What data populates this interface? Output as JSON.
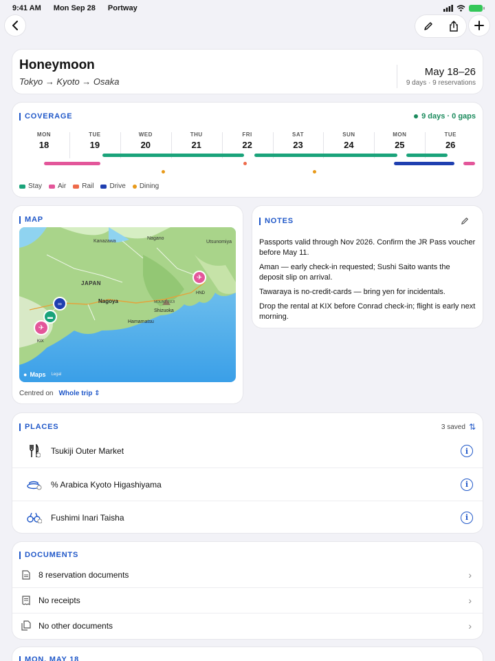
{
  "status": {
    "time": "9:41 AM",
    "date": "Mon Sep 28",
    "app": "Portway"
  },
  "trip": {
    "title": "Honeymoon",
    "route": "Tokyo → Kyoto → Osaka",
    "dates": "May 18–26",
    "summary": "9 days · 9 reservations"
  },
  "coverage": {
    "title": "COVERAGE",
    "status": "9 days · 0 gaps",
    "days": [
      {
        "dow": "MON",
        "num": "18"
      },
      {
        "dow": "TUE",
        "num": "19"
      },
      {
        "dow": "WED",
        "num": "20"
      },
      {
        "dow": "THU",
        "num": "21"
      },
      {
        "dow": "FRI",
        "num": "22"
      },
      {
        "dow": "SAT",
        "num": "23"
      },
      {
        "dow": "SUN",
        "num": "24"
      },
      {
        "dow": "MON",
        "num": "25"
      },
      {
        "dow": "TUE",
        "num": "26"
      }
    ],
    "legend": [
      {
        "label": "Stay",
        "color": "#1aa37a"
      },
      {
        "label": "Air",
        "color": "#e3569a"
      },
      {
        "label": "Rail",
        "color": "#ee6a4a"
      },
      {
        "label": "Drive",
        "color": "#1f3fb0"
      },
      {
        "label": "Dining",
        "color": "#e89a1a"
      }
    ]
  },
  "map": {
    "title": "MAP",
    "labels": {
      "kanazawa": "Kanazawa",
      "nagano": "Nagano",
      "utsunomiya": "Utsunomiya",
      "japan": "JAPAN",
      "nagoya": "Nagoya",
      "mountfuji": "MOUNT FUJI",
      "shizuoka": "Shizuoka",
      "hamamatsu": "Hamamatsu",
      "hnd": "HND",
      "kix": "KIX"
    },
    "attribution": "Maps",
    "legal": "Legal",
    "centred_label": "Centred on",
    "centred_value": "Whole trip"
  },
  "notes": {
    "title": "NOTES",
    "items": [
      "Passports valid through Nov 2026. Confirm the JR Pass voucher before May 11.",
      "Aman — early check-in requested; Sushi Saito wants the deposit slip on arrival.",
      "Tawaraya is no-credit-cards — bring yen for incidentals.",
      "Drop the rental at KIX before Conrad check-in; flight is early next morning."
    ]
  },
  "places": {
    "title": "PLACES",
    "count": "3 saved",
    "items": [
      {
        "name": "Tsukiji Outer Market",
        "icon": "fork-knife-icon"
      },
      {
        "name": "% Arabica Kyoto Higashiyama",
        "icon": "coffee-cup-icon"
      },
      {
        "name": "Fushimi Inari Taisha",
        "icon": "binoculars-icon"
      }
    ]
  },
  "documents": {
    "title": "DOCUMENTS",
    "items": [
      {
        "label": "8 reservation documents",
        "icon": "document-icon"
      },
      {
        "label": "No receipts",
        "icon": "receipt-icon"
      },
      {
        "label": "No other documents",
        "icon": "documents-stack-icon"
      }
    ]
  },
  "next_section": {
    "title": "MON, MAY 18"
  }
}
